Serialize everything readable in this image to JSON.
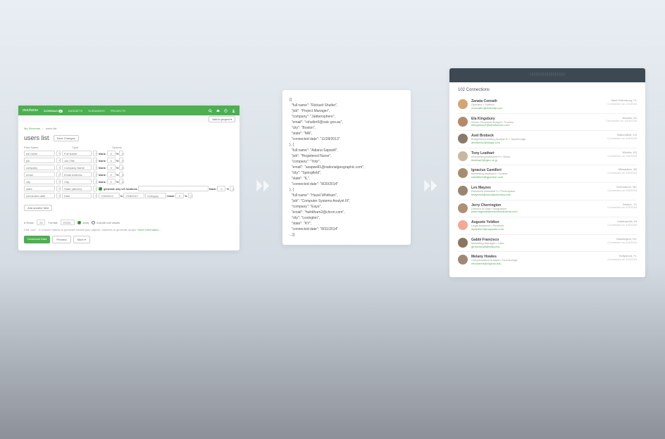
{
  "panel1": {
    "logo": "mockaroo",
    "nav": {
      "schemas": "SCHEMAS",
      "schemas_badge": "2",
      "datasets": "DATASETS",
      "scenarios": "SCENARIOS",
      "projects": "PROJECTS"
    },
    "add_to_project": "Add to project ▾",
    "crumb_a": "My Schemas",
    "crumb_sep": "›",
    "crumb_b": "users list",
    "title": "users list",
    "save": "Save Changes",
    "col_fieldname": "Field Name",
    "col_type": "Type",
    "col_options": "Options",
    "rows": [
      {
        "name": "full name",
        "type": "Full Name"
      },
      {
        "name": "job",
        "type": "Job Title"
      },
      {
        "name": "company",
        "type": "Company Name"
      },
      {
        "name": "email",
        "type": "Email Address"
      },
      {
        "name": "city",
        "type": "City"
      },
      {
        "name": "state",
        "type": "State (abbrev)"
      },
      {
        "name": "connected date",
        "type": "Date"
      }
    ],
    "opt_blank": "blank:",
    "opt_zero": "0",
    "opt_pct": "%",
    "opt_fx": "ƒx",
    "state_opt": "generate only US locations",
    "date_min": "7/28/2012",
    "date_to": "to",
    "date_max": "7/28/2017",
    "date_fmt": "m/d/yyyy",
    "add_field": "Add another field",
    "footer_rows": "# Rows:",
    "footer_rows_v": "20",
    "footer_format": "Format:",
    "footer_format_v": "JSON",
    "footer_array": "array",
    "footer_null": "include null values",
    "hint": "Hint: Use '.' in column names to generate nested json objects, brackets to generate arrays.  ",
    "hint_link": "More information...",
    "btn_dl": "Download Data",
    "btn_preview": "Preview",
    "btn_more": "More ▾"
  },
  "panel2": {
    "json": "[{\n  \"full name\": \"Rickard Shutler\",\n  \"job\": \"Project Manager\",\n  \"company\": \"Jabbersphere\",\n  \"email\": \"rshutler0@oaic.gov.au\",\n  \"city\": \"Boston\",\n  \"state\": \"MA\",\n  \"connected date\": \"11/28/2013\"\n}, {\n  \"full name\": \"Adiana Sapwell\",\n  \"job\": \"Registered Nurse\",\n  \"company\": \"Yotz\",\n  \"email\": \"asapwell1@nationalgeographic.com\",\n  \"city\": \"Springfield\",\n  \"state\": \"IL\",\n  \"connected date\": \"8/20/2014\"\n}, {\n  \"full name\": \"Hazel Whitham\",\n  \"job\": \"Computer Systems Analyst III\",\n  \"company\": \"Eayo\",\n  \"email\": \"hwhitham2@chron.com\",\n  \"city\": \"Lexington\",\n  \"state\": \"KY\",\n  \"connected date\": \"8/31/2014\"\n...}]"
  },
  "panel3": {
    "title": "102 Connections",
    "rows": [
      {
        "name": "Zanata Conrath",
        "job": "Operator • Twitbox",
        "email": "zconrath0@redbelly.com",
        "loc": "Saint Petersburg, FL",
        "date": "Connected on 2/2/2018",
        "av": "#d4a574"
      },
      {
        "name": "Ela Kingsbury",
        "job": "Senior Financial Analyst • Trombu",
        "email": "ekingsbury1@windhorses.com",
        "loc": "Newark, NJ",
        "date": "Connected on 10/4/2018",
        "av": "#b5896a"
      },
      {
        "name": "Axel Brobeck",
        "job": "Budget/Accounting Analyst IV • Topiclounge",
        "email": "abrobeck2@blogs.com",
        "loc": "Bakersfield, CA",
        "date": "Connected on 6/4/2018",
        "av": "#8a7a6a"
      },
      {
        "name": "Tony Leathart",
        "job": "Accounting Assistant IV • Wodj",
        "email": "tleathart3@geo.ne.jp",
        "loc": "Wichita, KS",
        "date": "Connected on 4/5/2018",
        "av": "#c9b8a0"
      },
      {
        "name": "Ignacius Camilleri",
        "job": "Marketing Assistant • Youbee",
        "email": "icamilleri4@gpordon.com",
        "loc": "Milwaukee, WI",
        "date": "Connected on 4/5/2018",
        "av": "#a88c70"
      },
      {
        "name": "Les Mayzes",
        "job": "Research Assistant II • Photospace",
        "email": "lmayzes5@sundaymonkey.com",
        "loc": "Greensboro, NC",
        "date": "Connected on 6/3/2018",
        "av": "#9a8570"
      },
      {
        "name": "Jerry Cherrington",
        "job": "Director of Sale • Blognation",
        "email": "jcherrington6@networksolutions.com",
        "loc": "Denton, TX",
        "date": "Connected on 2/4/2018",
        "av": "#b09075"
      },
      {
        "name": "Auguste Yoldton",
        "job": "Legal Assistant • Realindo",
        "email": "ayoldton7@mayosite.com",
        "loc": "Indianapolis, IN",
        "date": "Connected on 4/6/2018",
        "av": "#f4a896"
      },
      {
        "name": "Gabbi Francisco",
        "job": "Marketing Manager • Lake",
        "email": "gfrancisco8@eddy.edu",
        "loc": "Washington, DC",
        "date": "Connected on 6/3/2018",
        "av": "#8b7560"
      },
      {
        "name": "Melany Howles",
        "job": "Compensation Analyst • Zoomlounge",
        "email": "mhowles9@virginia.edu",
        "loc": "Hollywood, FL",
        "date": "Connected on 4/2/2018",
        "av": "#a08878"
      }
    ]
  }
}
